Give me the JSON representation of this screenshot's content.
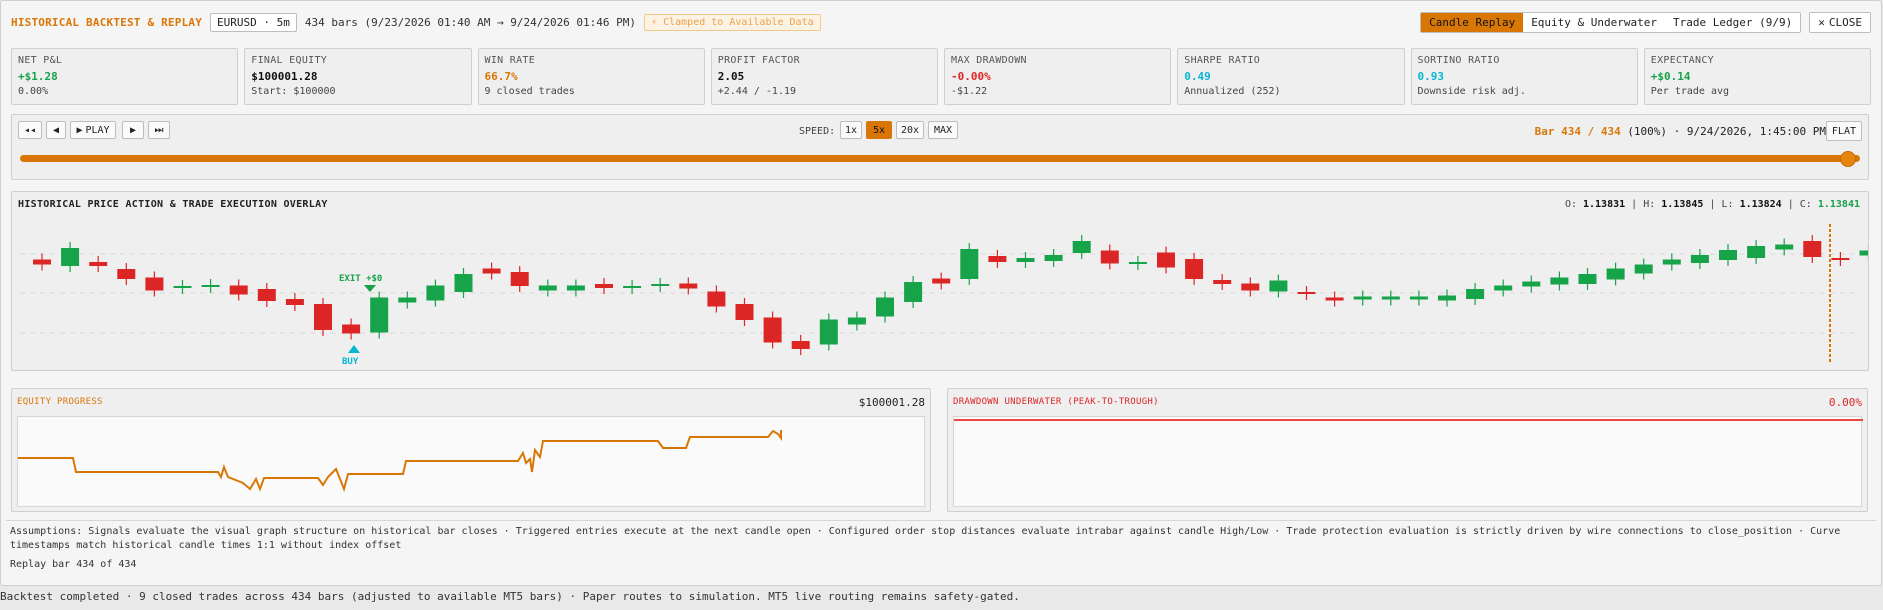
{
  "header": {
    "title": "HISTORICAL BACKTEST & REPLAY",
    "symbol_chip": "EURUSD · 5m",
    "bars_info": "434 bars (9/23/2026 01:40 AM → 9/24/2026 01:46 PM)",
    "clamp_badge": "Clamped to Available Data",
    "tabs": [
      "Candle Replay",
      "Equity & Underwater",
      "Trade Ledger (9/9)"
    ],
    "active_tab": "Candle Replay",
    "close_label": "CLOSE"
  },
  "metrics": [
    {
      "label": "NET P&L",
      "value": "+$1.28",
      "sub": "0.00%",
      "color": "#16a34a"
    },
    {
      "label": "FINAL EQUITY",
      "value": "$100001.28",
      "sub": "Start: $100000",
      "color": "#111111"
    },
    {
      "label": "WIN RATE",
      "value": "66.7%",
      "sub": "9 closed trades",
      "color": "#d97706"
    },
    {
      "label": "PROFIT FACTOR",
      "value": "2.05",
      "sub": "+2.44 / -1.19",
      "color": "#111111"
    },
    {
      "label": "MAX DRAWDOWN",
      "value": "-0.00%",
      "sub": "-$1.22",
      "color": "#dc2626"
    },
    {
      "label": "SHARPE RATIO",
      "value": "0.49",
      "sub": "Annualized (252)",
      "color": "#06b6d4"
    },
    {
      "label": "SORTINO RATIO",
      "value": "0.93",
      "sub": "Downside risk adj.",
      "color": "#06b6d4"
    },
    {
      "label": "EXPECTANCY",
      "value": "+$0.14",
      "sub": "Per trade avg",
      "color": "#16a34a"
    }
  ],
  "replay": {
    "play_label": "PLAY",
    "speed_label": "SPEED:",
    "speeds": [
      "1x",
      "5x",
      "20x",
      "MAX"
    ],
    "active_speed": "5x",
    "bar_position": "Bar 434 / 434",
    "bar_rest": "(100%) · 9/24/2026, 1:45:00 PM",
    "flat_label": "FLAT",
    "progress": 1.0
  },
  "price_chart": {
    "title": "HISTORICAL PRICE ACTION & TRADE EXECUTION OVERLAY",
    "ohlc": {
      "o": "1.13831",
      "h": "1.13845",
      "l": "1.13824",
      "c": "1.13841"
    },
    "markers": {
      "exit": "EXIT +$0",
      "buy": "BUY"
    }
  },
  "equity": {
    "title": "EQUITY PROGRESS",
    "value": "$100001.28"
  },
  "drawdown": {
    "title": "DRAWDOWN UNDERWATER (PEAK-TO-TROUGH)",
    "value": "0.00%"
  },
  "assumptions": "Assumptions: Signals evaluate the visual graph structure on historical bar closes · Triggered entries execute at the next candle open · Configured order stop distances evaluate intrabar against candle High/Low · Trade protection evaluation is strictly driven by wire connections to close_position · Curve timestamps match historical candle times 1:1 without index offset",
  "replay_note": "Replay bar 434 of 434",
  "status_bar": "Backtest completed · 9 closed trades across 434 bars (adjusted to available MT5 bars) · Paper routes to simulation. MT5 live routing remains safety-gated.",
  "colors": {
    "accent": "#d97706",
    "up": "#16a34a",
    "down": "#dc2626",
    "cyan": "#06b6d4"
  },
  "chart_data": {
    "type": "candlestick",
    "candles_dir": [
      "d",
      "u",
      "d",
      "d",
      "d",
      "u",
      "u",
      "d",
      "d",
      "d",
      "d",
      "d",
      "u",
      "u",
      "u",
      "u",
      "d",
      "d",
      "u",
      "u",
      "d",
      "u",
      "u",
      "d",
      "d",
      "d",
      "d",
      "d",
      "u",
      "u",
      "u",
      "u",
      "d",
      "u",
      "d",
      "u",
      "u",
      "u",
      "d",
      "u",
      "d",
      "d",
      "d",
      "d",
      "u",
      "d",
      "d",
      "u",
      "u",
      "u",
      "u",
      "u",
      "u",
      "u",
      "u",
      "u",
      "u",
      "u",
      "u",
      "u",
      "u",
      "u",
      "u",
      "d",
      "d",
      "u"
    ],
    "note_ohlc_last": {
      "o": 1.13831,
      "h": 1.13845,
      "l": 1.13824,
      "c": 1.13841
    }
  }
}
